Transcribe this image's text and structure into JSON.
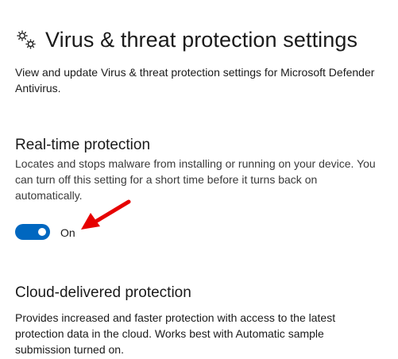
{
  "header": {
    "title": "Virus & threat protection settings",
    "description": "View and update Virus & threat protection settings for Microsoft Defender Antivirus.",
    "icon": "gears-icon"
  },
  "realtime": {
    "title": "Real-time protection",
    "description_lines": [
      "Locates and stops malware from installing or running on your device. You",
      "can turn off this setting for a short time before it turns back on",
      "automatically."
    ],
    "toggle_state": "On",
    "toggle_on": true
  },
  "cloud": {
    "title": "Cloud-delivered protection",
    "description_lines": [
      "Provides increased and faster protection with access to the latest",
      "protection data in the cloud. Works best with Automatic sample",
      "submission turned on."
    ]
  },
  "colors": {
    "toggle_on": "#0067c0",
    "annotation_arrow": "#e60000"
  }
}
